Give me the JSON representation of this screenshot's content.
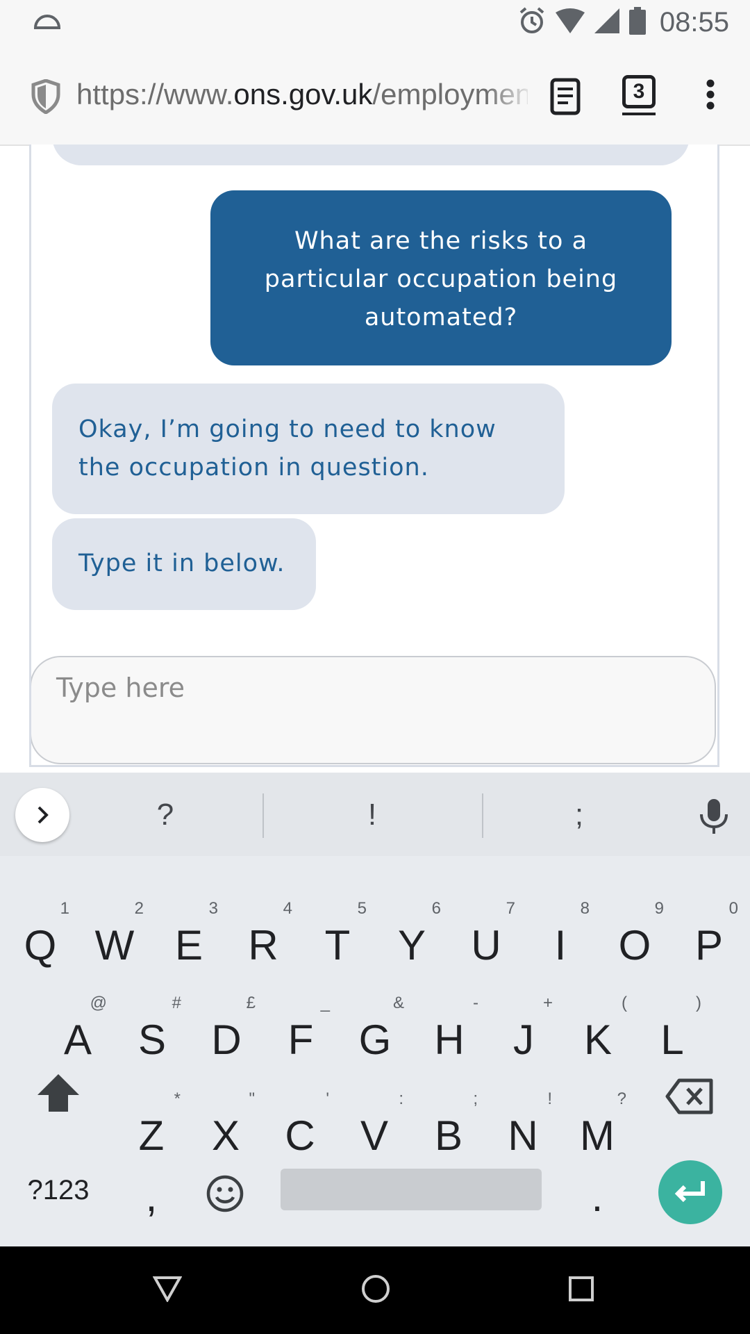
{
  "status_bar": {
    "time": "08:55"
  },
  "browser": {
    "url_prefix": "https://www.",
    "url_domain": "ons.gov.uk",
    "url_path": "/employment",
    "tab_count": "3"
  },
  "chat": {
    "messages": [
      {
        "from": "user",
        "text": "What are the risks to a particular occupation being automated?"
      },
      {
        "from": "bot",
        "text": "Okay, I’m going to need to know the occupation in question."
      },
      {
        "from": "bot",
        "text": "Type it in below."
      }
    ],
    "input_placeholder": "Type here"
  },
  "keyboard": {
    "suggestions": [
      "?",
      "!",
      ";"
    ],
    "row1": [
      {
        "key": "Q",
        "hint": "1"
      },
      {
        "key": "W",
        "hint": "2"
      },
      {
        "key": "E",
        "hint": "3"
      },
      {
        "key": "R",
        "hint": "4"
      },
      {
        "key": "T",
        "hint": "5"
      },
      {
        "key": "Y",
        "hint": "6"
      },
      {
        "key": "U",
        "hint": "7"
      },
      {
        "key": "I",
        "hint": "8"
      },
      {
        "key": "O",
        "hint": "9"
      },
      {
        "key": "P",
        "hint": "0"
      }
    ],
    "row2": [
      {
        "key": "A",
        "hint": "@"
      },
      {
        "key": "S",
        "hint": "#"
      },
      {
        "key": "D",
        "hint": "£"
      },
      {
        "key": "F",
        "hint": "_"
      },
      {
        "key": "G",
        "hint": "&"
      },
      {
        "key": "H",
        "hint": "-"
      },
      {
        "key": "J",
        "hint": "+"
      },
      {
        "key": "K",
        "hint": "("
      },
      {
        "key": "L",
        "hint": ")"
      }
    ],
    "row3": [
      {
        "key": "Z",
        "hint": "*"
      },
      {
        "key": "X",
        "hint": "\""
      },
      {
        "key": "C",
        "hint": "'"
      },
      {
        "key": "V",
        "hint": ":"
      },
      {
        "key": "B",
        "hint": ";"
      },
      {
        "key": "N",
        "hint": "!"
      },
      {
        "key": "M",
        "hint": "?"
      }
    ],
    "symbols_label": "?123",
    "comma_label": ",",
    "period_label": ".",
    "enter_color": "#3bb3a0"
  },
  "colors": {
    "user_bubble": "#206095",
    "bot_bubble": "#dfe4ed",
    "bot_text": "#206095"
  }
}
